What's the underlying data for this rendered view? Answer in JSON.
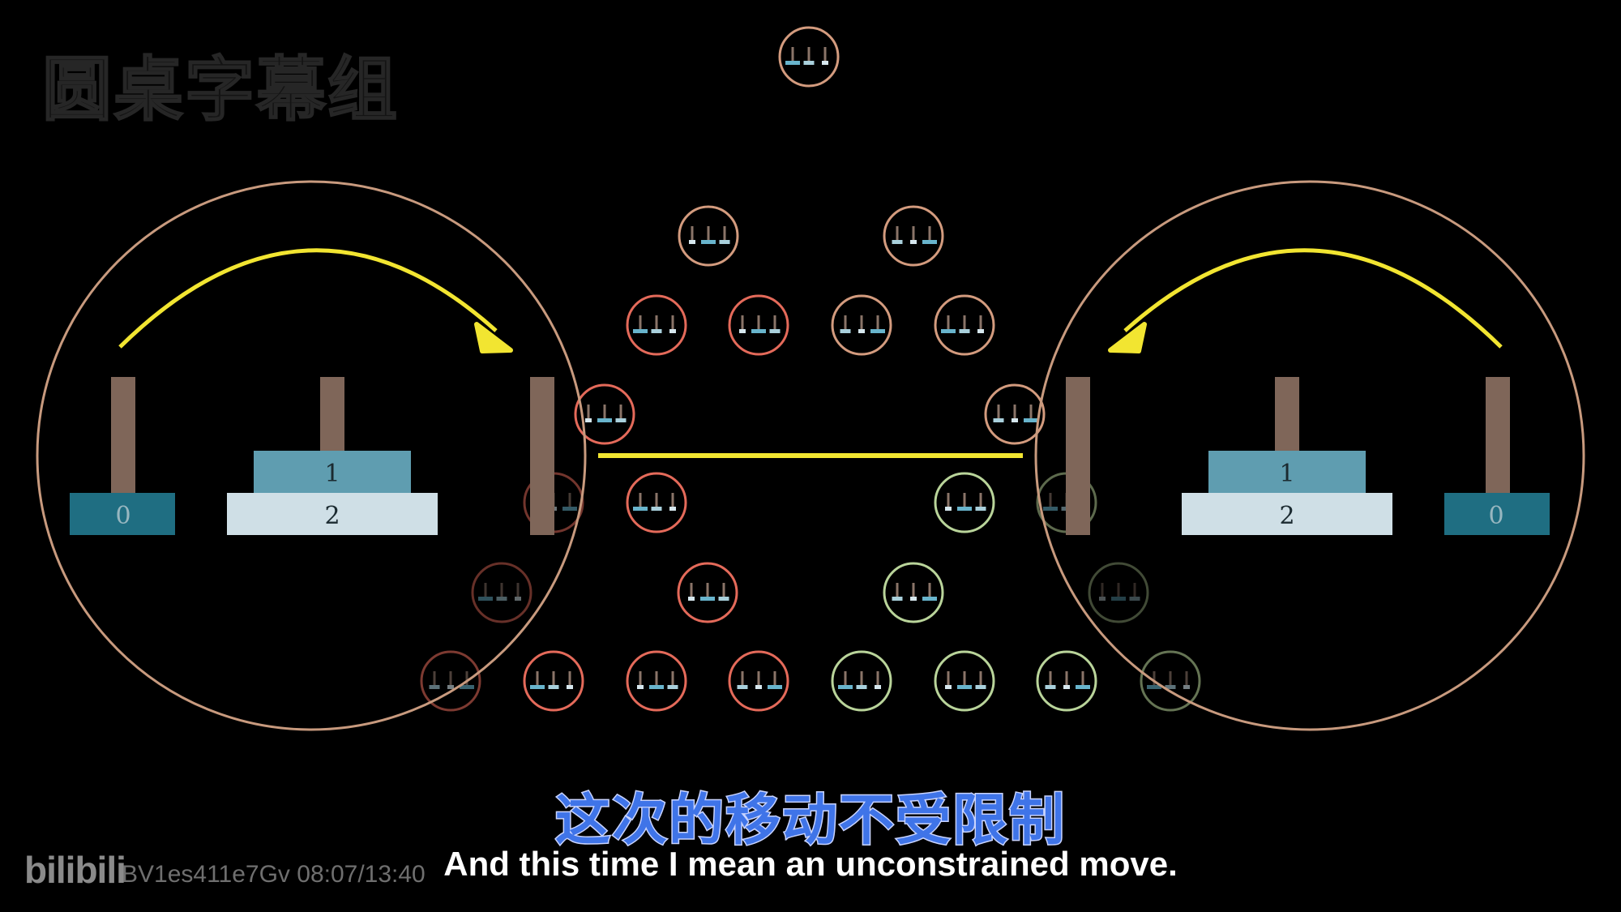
{
  "watermark": "圆桌字幕组",
  "subtitle_zh": "这次的移动不受限制",
  "subtitle_en": "And this time I mean an unconstrained move.",
  "player": {
    "logo": "bilibili",
    "video_id_time": "BV1es411e7Gv 08:07/13:40"
  },
  "left_state": {
    "disks": [
      "0",
      "1",
      "2"
    ]
  },
  "right_state": {
    "disks": [
      "1",
      "2",
      "0"
    ]
  },
  "colors": {
    "background": "#000000",
    "big_circle": "#c89a7e",
    "arrow": "#f2e531",
    "peg": "#7f6659",
    "disk_dark": "#1f6e82",
    "disk_mid": "#5f9db0",
    "disk_light": "#cfdfe6",
    "node_red": "#e46a5a",
    "node_peach": "#d39b7e",
    "node_green": "#b9d49a",
    "node_tiny": "#68b4cc"
  }
}
